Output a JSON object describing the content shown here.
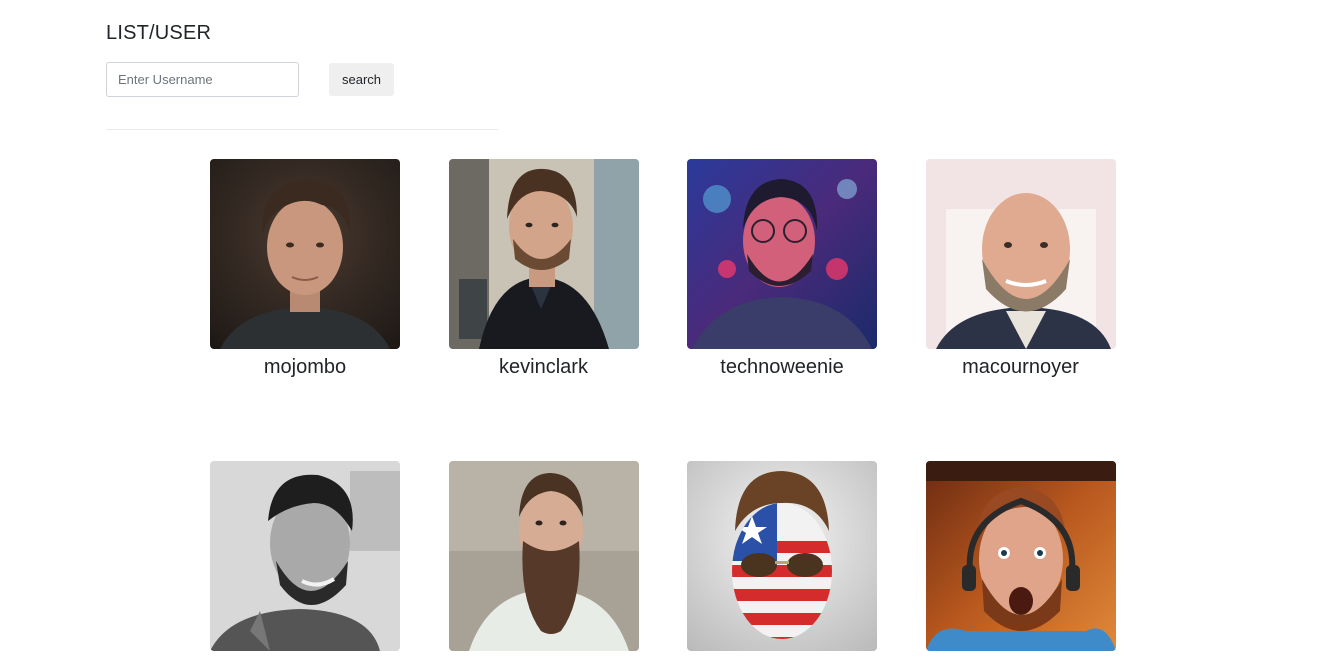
{
  "header": {
    "title": "LIST/USER"
  },
  "search": {
    "placeholder": "Enter Username",
    "value": "",
    "button_label": "search"
  },
  "users": [
    {
      "login": "mojombo"
    },
    {
      "login": "kevinclark"
    },
    {
      "login": "technoweenie"
    },
    {
      "login": "macournoyer"
    },
    {
      "login": ""
    },
    {
      "login": ""
    },
    {
      "login": ""
    },
    {
      "login": ""
    }
  ]
}
